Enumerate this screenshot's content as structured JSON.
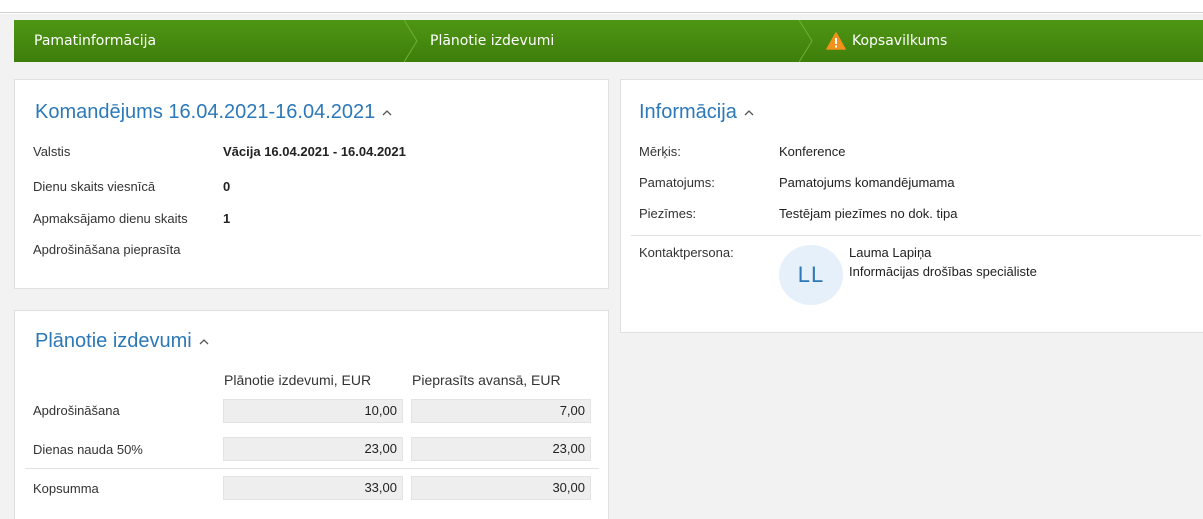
{
  "wizard": {
    "steps": [
      "Pamatinformācija",
      "Plānotie izdevumi",
      "Kopsavilkums"
    ]
  },
  "komandejums": {
    "title": "Komandējums 16.04.2021-16.04.2021",
    "rows": [
      {
        "label": "Valstis",
        "value": "Vācija 16.04.2021 - 16.04.2021"
      },
      {
        "label": "Dienu skaits viesnīcā",
        "value": "0"
      },
      {
        "label": "Apmaksājamo dienu skaits",
        "value": "1"
      },
      {
        "label": "Apdrošināšana pieprasīta",
        "value": ""
      }
    ]
  },
  "izdevumi": {
    "title": "Plānotie izdevumi",
    "columns": [
      "Plānotie izdevumi, EUR",
      "Pieprasīts avansā, EUR"
    ],
    "rows": [
      {
        "label": "Apdrošināšana",
        "planned": "10,00",
        "advance": "7,00"
      },
      {
        "label": "Dienas nauda 50%",
        "planned": "23,00",
        "advance": "23,00"
      },
      {
        "label": "Kopsumma",
        "planned": "33,00",
        "advance": "30,00"
      }
    ]
  },
  "informacija": {
    "title": "Informācija",
    "rows": [
      {
        "label": "Mērķis:",
        "value": "Konference"
      },
      {
        "label": "Pamatojums:",
        "value": "Pamatojums komandējumama"
      },
      {
        "label": "Piezīmes:",
        "value": "Testējam piezīmes no dok. tipa"
      }
    ],
    "contact": {
      "label": "Kontaktpersona:",
      "initials": "LL",
      "name": "Lauma Lapiņa",
      "role": "Informācijas drošības speciāliste"
    }
  },
  "colors": {
    "wizard_green": "#4a8f12",
    "title_blue": "#2c78b8",
    "warning_orange": "#f2911b"
  }
}
